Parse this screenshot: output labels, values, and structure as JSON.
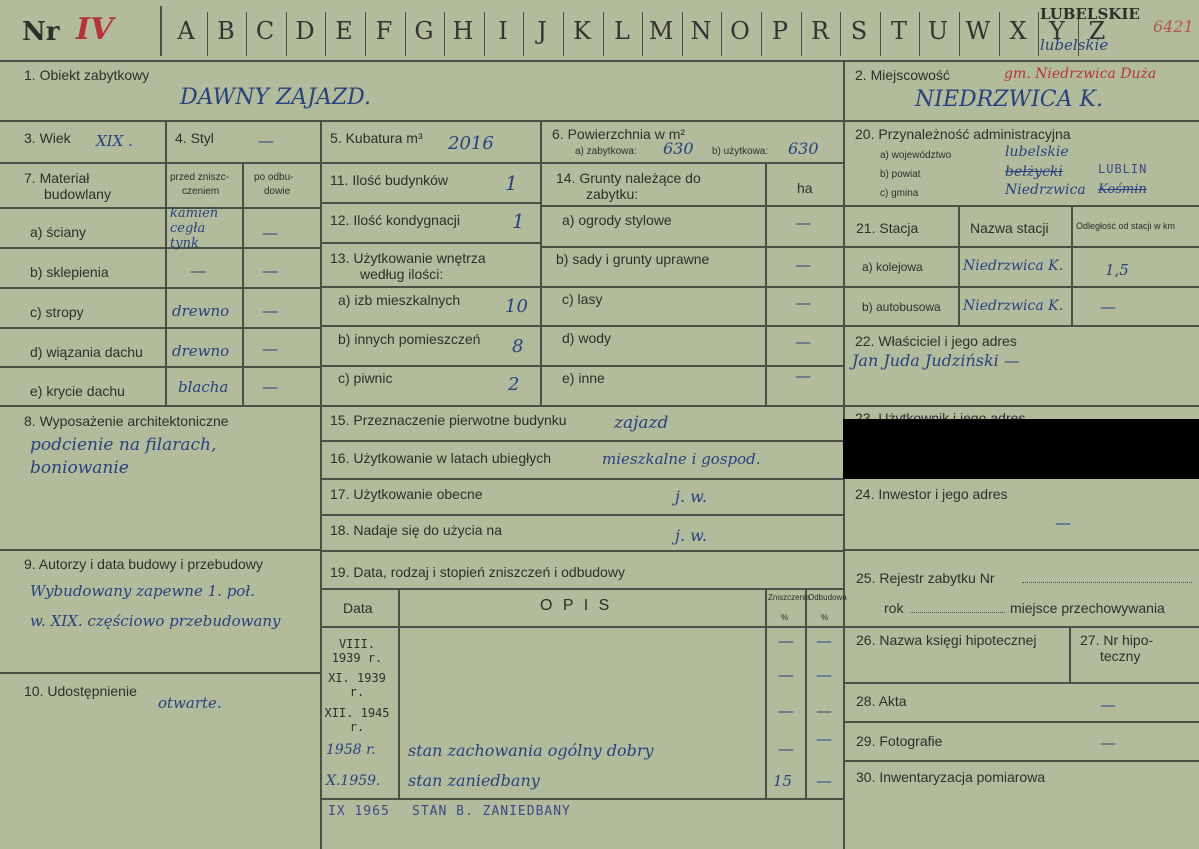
{
  "header": {
    "nr_label": "Nr",
    "nr_value": "IV",
    "letters": [
      "A",
      "B",
      "C",
      "D",
      "E",
      "F",
      "G",
      "H",
      "I",
      "J",
      "K",
      "L",
      "M",
      "N",
      "O",
      "P",
      "R",
      "S",
      "T",
      "U",
      "W",
      "X",
      "Y",
      "Z"
    ],
    "printed_region": "LUBELSKIE",
    "handwritten_region": "lubelskie",
    "card_number": "6421"
  },
  "f1": {
    "label": "1. Obiekt zabytkowy",
    "value": "DAWNY ZAJAZD."
  },
  "f2": {
    "label": "2. Miejscowość",
    "note": "gm. Niedrzwica Duża",
    "value": "NIEDRZWICA K."
  },
  "f3": {
    "label": "3. Wiek",
    "value": "XIX ."
  },
  "f4": {
    "label": "4. Styl",
    "value": "—"
  },
  "f5": {
    "label": "5. Kubatura m³",
    "value": "2016"
  },
  "f6": {
    "label": "6. Powierzchnia w m²",
    "a_label": "a) zabytkowa:",
    "a_value": "630",
    "b_label": "b) użytkowa:",
    "b_value": "630"
  },
  "f20": {
    "label": "20. Przynależność administracyjna",
    "a_label": "a) województwo",
    "a_value": "lubelskie",
    "b_label": "b) powiat",
    "b_value": "bełżycki",
    "b_stamp": "LUBLIN",
    "c_label": "c) gmina",
    "c_value": "Niedrzwica",
    "c_extra": "Kośmin"
  },
  "f7": {
    "label1": "7. Materiał",
    "label2": "budowlany",
    "col1a": "przed zniszc-",
    "col1b": "czeniem",
    "col2a": "po odbu-",
    "col2b": "dowie",
    "rows": [
      {
        "label": "a) ściany",
        "before": "kamień cegła tynk",
        "after": "—"
      },
      {
        "label": "b) sklepienia",
        "before": "—",
        "after": "—"
      },
      {
        "label": "c) stropy",
        "before": "drewno",
        "after": "—"
      },
      {
        "label": "d) wiązania dachu",
        "before": "drewno",
        "after": "—"
      },
      {
        "label": "e) krycie dachu",
        "before": "blacha",
        "after": "—"
      }
    ]
  },
  "f11": {
    "label": "11. Ilość budynków",
    "value": "1"
  },
  "f12": {
    "label": "12. Ilość kondygnacji",
    "value": "1"
  },
  "f13": {
    "label1": "13. Użytkowanie wnętrza",
    "label2": "według ilości:",
    "rows": [
      {
        "label": "a) izb mieszkalnych",
        "value": "10"
      },
      {
        "label": "b) innych pomieszczeń",
        "value": "8"
      },
      {
        "label": "c) piwnic",
        "value": "2"
      }
    ]
  },
  "f14": {
    "label1": "14. Grunty należące do",
    "label2": "zabytku:",
    "unit": "ha",
    "rows": [
      {
        "label": "a) ogrody stylowe",
        "value": "—"
      },
      {
        "label": "b) sady i grunty uprawne",
        "value": "—"
      },
      {
        "label": "c) lasy",
        "value": "—"
      },
      {
        "label": "d) wody",
        "value": "—"
      },
      {
        "label": "e) inne",
        "value": "—"
      }
    ]
  },
  "f21": {
    "label": "21. Stacja",
    "col_name": "Nazwa stacji",
    "col_dist": "Odległość od stacji w km",
    "rows": [
      {
        "label": "a) kolejowa",
        "name": "Niedrzwica K.",
        "dist": "1,5"
      },
      {
        "label": "b) autobusowa",
        "name": "Niedrzwica K.",
        "dist": "—"
      }
    ]
  },
  "f22": {
    "label": "22. Właściciel i jego adres",
    "value": "Jan Juda Judziński —"
  },
  "f23": {
    "label": "23. Użytkownik i jego adres"
  },
  "f8": {
    "label": "8. Wyposażenie architektoniczne",
    "line1": "podcienie na filarach,",
    "line2": "boniowanie"
  },
  "f15": {
    "label": "15. Przeznaczenie pierwotne budynku",
    "value": "zajazd"
  },
  "f16": {
    "label": "16. Użytkowanie w latach ubiegłych",
    "value": "mieszkalne i gospod."
  },
  "f17": {
    "label": "17. Użytkowanie obecne",
    "value": "j. w."
  },
  "f18": {
    "label": "18. Nadaje się do użycia na",
    "value": "j. w."
  },
  "f24": {
    "label": "24. Inwestor i jego adres",
    "value": "—"
  },
  "f9": {
    "label": "9. Autorzy i data budowy i przebudowy",
    "line1": "Wybudowany zapewne 1. poł.",
    "line2": "w. XIX. częściowo przebudowany"
  },
  "f19": {
    "label": "19. Data, rodzaj i stopień zniszczeń i odbudowy",
    "col_date": "Data",
    "col_desc": "O P I S",
    "col_z1": "Zniszczenia",
    "col_z2": "%",
    "col_o1": "Odbudowa",
    "col_o2": "%",
    "rows": [
      {
        "date": "VIII. 1939 r.",
        "desc": "",
        "z": "—",
        "o": "—"
      },
      {
        "date": "XI. 1939 r.",
        "desc": "",
        "z": "—",
        "o": "—"
      },
      {
        "date": "XII. 1945 r.",
        "desc": "",
        "z": "—",
        "o": "—"
      },
      {
        "date": "1958 r.",
        "desc": "stan zachowania ogólny dobry",
        "z": "—",
        "o": "—"
      },
      {
        "date": "X.1959.",
        "desc": "stan zaniedbany",
        "z": "15",
        "o": "—"
      }
    ],
    "extra_date": "IX 1965",
    "extra_desc": "STAN B. ZANIEDBANY"
  },
  "f25": {
    "label": "25. Rejestr zabytku Nr",
    "rok": "rok",
    "miejsce": "miejsce przechowywania"
  },
  "f10": {
    "label": "10. Udostępnienie",
    "value": "otwarte."
  },
  "f26": {
    "label": "26. Nazwa księgi hipotecznej"
  },
  "f27": {
    "label1": "27. Nr hipo-",
    "label2": "teczny"
  },
  "f28": {
    "label": "28. Akta",
    "value": "—"
  },
  "f29": {
    "label": "29. Fotografie",
    "value": "—"
  },
  "f30": {
    "label": "30. Inwentaryzacja pomiarowa"
  }
}
